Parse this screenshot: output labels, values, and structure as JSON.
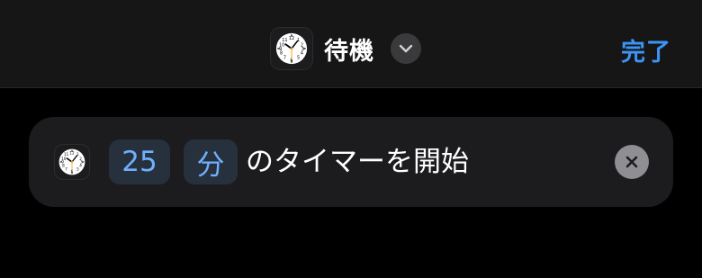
{
  "header": {
    "title": "待機",
    "done_label": "完了",
    "app_icon": "clock-icon",
    "dropdown_icon": "chevron-down-icon"
  },
  "action": {
    "icon": "clock-icon",
    "duration_value": "25",
    "duration_unit": "分",
    "text": "のタイマーを開始",
    "clear_icon": "close-icon"
  },
  "colors": {
    "accent": "#3b95f6",
    "token_text": "#6fb0ff",
    "token_bg": "#27303d",
    "card_bg": "#1c1c1e",
    "nav_bg": "#161616",
    "background": "#000000"
  }
}
